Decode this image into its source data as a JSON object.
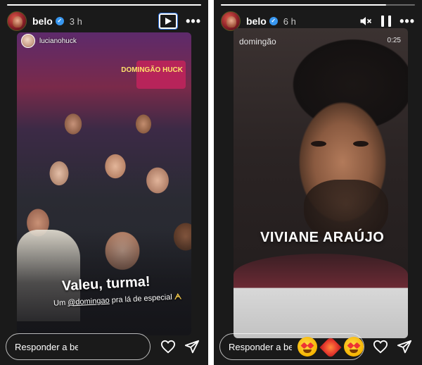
{
  "left_story": {
    "progress": 1.0,
    "user": {
      "username": "belo",
      "verified": true,
      "time_ago": "3 h"
    },
    "controls": {
      "play_icon": "play-icon",
      "more_icon": "more-icon"
    },
    "mention": {
      "username": "lucianohuck"
    },
    "photo_sign_text": "DOMINGÃO HUCK",
    "caption": {
      "title": "Valeu, turma!",
      "prefix": "Um",
      "tag": "@domingao",
      "suffix": "pra lá de especial",
      "emoji": "ᗅ"
    },
    "reply": {
      "placeholder": "Responder a belo..."
    },
    "actions": {
      "like_icon": "heart-outline-icon",
      "share_icon": "send-icon"
    }
  },
  "right_story": {
    "progress": 0.85,
    "user": {
      "username": "belo",
      "verified": true,
      "time_ago": "6 h"
    },
    "controls": {
      "mute_icon": "mute-icon",
      "pause_icon": "pause-icon",
      "more_icon": "more-icon"
    },
    "channel": "domingão",
    "duration": "0:25",
    "name_overlay": "VIVIANE ARAÚJO",
    "reply": {
      "placeholder": "Responder a belo..."
    },
    "quick_reactions": [
      "heart-eyes-emoji",
      "heart-on-fire-emoji",
      "heart-eyes-emoji"
    ],
    "actions": {
      "like_icon": "heart-outline-icon",
      "share_icon": "send-icon"
    }
  }
}
